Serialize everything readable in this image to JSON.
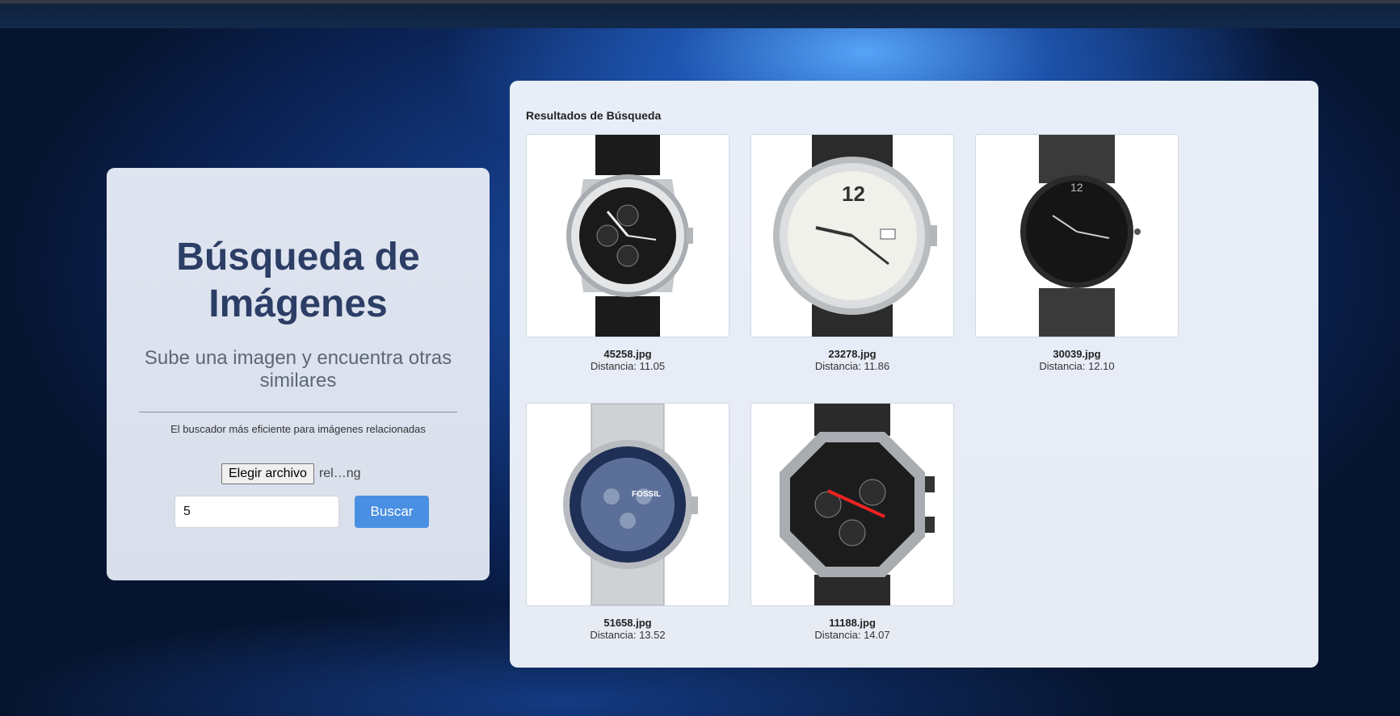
{
  "page": {
    "title_line1": "Búsqueda de",
    "title_line2": "Imágenes",
    "subtitle": "Sube una imagen y encuentra otras similares",
    "tagline": "El buscador más eficiente para imágenes relacionadas"
  },
  "form": {
    "file_button_label": "Elegir archivo",
    "file_name": "rel…ng",
    "count_value": "5",
    "search_label": "Buscar"
  },
  "results": {
    "title": "Resultados de Búsqueda",
    "items": [
      {
        "file": "45258.jpg",
        "distance": "Distancia: 11.05",
        "image": "watch-chronograph-black-dial-silver-case"
      },
      {
        "file": "23278.jpg",
        "distance": "Distancia: 11.86",
        "image": "watch-white-dial-black-strap"
      },
      {
        "file": "30039.jpg",
        "distance": "Distancia: 12.10",
        "image": "watch-black-minimalist-mesh-strap"
      },
      {
        "file": "51658.jpg",
        "distance": "Distancia: 13.52",
        "image": "watch-blue-dial-steel-bracelet"
      },
      {
        "file": "11188.jpg",
        "distance": "Distancia: 14.07",
        "image": "watch-octagonal-black-chronograph"
      }
    ]
  },
  "colors": {
    "accent": "#4a90e2",
    "title": "#2c3e66",
    "card": "#dfe5f0"
  }
}
